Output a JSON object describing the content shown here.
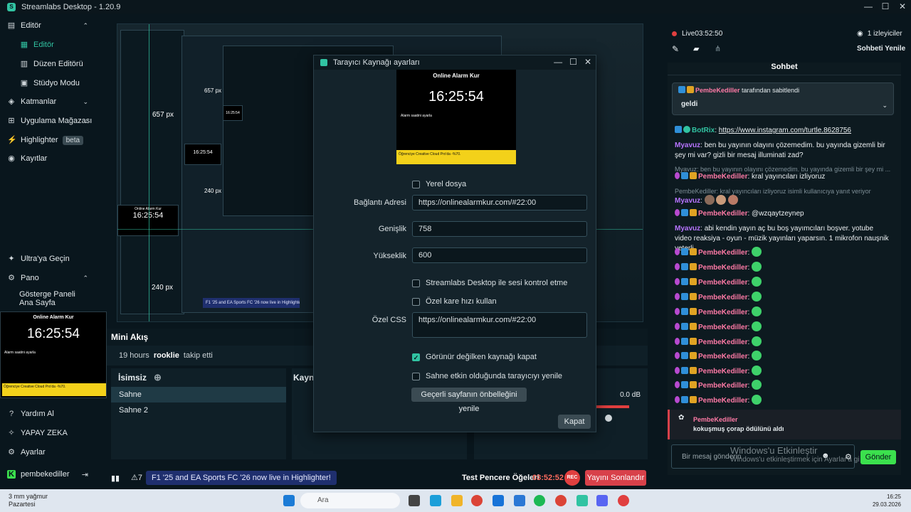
{
  "window": {
    "title": "Streamlabs Desktop - 1.20.9",
    "minimize": "—",
    "maximize": "☐",
    "close": "✕"
  },
  "sidebar": {
    "items": [
      {
        "label": "Editör",
        "icon": "layout-icon",
        "glyph": "▤",
        "chev": "⌃"
      },
      {
        "label": "Editör",
        "icon": "editor-icon",
        "glyph": "▦"
      },
      {
        "label": "Düzen Editörü",
        "icon": "layout-editor-icon",
        "glyph": "▥"
      },
      {
        "label": "Stüdyo Modu",
        "icon": "studio-mode-icon",
        "glyph": "▣"
      },
      {
        "label": "Katmanlar",
        "icon": "layers-icon",
        "glyph": "◈",
        "chev": "⌄"
      },
      {
        "label": "Uygulama Mağazası",
        "icon": "store-icon",
        "glyph": "⊞",
        "chev": "⌄"
      },
      {
        "label": "Highlighter",
        "icon": "highlighter-icon",
        "glyph": "⚡",
        "badge": "beta"
      },
      {
        "label": "Kayıtlar",
        "icon": "recordings-icon",
        "glyph": "◉"
      },
      {
        "label": "Ultra'ya Geçin",
        "icon": "ultra-icon",
        "glyph": "✦"
      },
      {
        "label": "Pano",
        "icon": "dashboard-icon",
        "glyph": "⚙",
        "chev": "⌃"
      },
      {
        "label": "Gösterge Paneli Ana Sayfa",
        "icon": "",
        "glyph": ""
      },
      {
        "label": "Yardım Al",
        "icon": "help-icon",
        "glyph": "?"
      },
      {
        "label": "YAPAY ZEKA",
        "icon": "ai-icon",
        "glyph": "✧"
      },
      {
        "label": "Ayarlar",
        "icon": "settings-icon",
        "glyph": "⚙"
      },
      {
        "label": "pembekediller",
        "icon": "kick-icon",
        "glyph": "K",
        "logout": "⇥"
      }
    ]
  },
  "clock": {
    "title": "Online Alarm Kur",
    "time": "16:25:54",
    "alarm_label": "Alarm saatini ayarla",
    "ad_text": "Öğrenciye Creative Cloud Pro'da -%70."
  },
  "preview_labels": {
    "px1": "657 px",
    "px2": "240 px",
    "px3": "240 px",
    "px4": "657 px"
  },
  "mini_stream": {
    "title": "Mini Akış",
    "time": "19 hours",
    "user": "rooklie",
    "action": "takip etti"
  },
  "scenes": {
    "title": "İsimsiz",
    "items": [
      "Sahne",
      "Sahne 2"
    ]
  },
  "sources": {
    "title": "Kayna"
  },
  "mixer": {
    "value": "0.0 dB"
  },
  "statusbar": {
    "news": "F1 '25 and EA Sports FC '26 now live in Highlighter!",
    "test_elements": "Test Pencere Öğeleri",
    "timer": "03:52:52",
    "rec": "REC",
    "end_stream": "Yayını Sonlandır",
    "notif_count": "7"
  },
  "dialog": {
    "title": "Tarayıcı Kaynağı ayarları",
    "local_file": "Yerel dosya",
    "url_label": "Bağlantı Adresi",
    "url_value": "https://onlinealarmkur.com/#22:00",
    "width_label": "Genişlik",
    "width_value": "758",
    "height_label": "Yükseklik",
    "height_value": "600",
    "audio_ctrl": "Streamlabs Desktop ile sesi kontrol etme",
    "custom_fps": "Özel kare hızı kullan",
    "css_label": "Özel CSS",
    "css_value": "https://onlinealarmkur.com/#22:00",
    "shutdown": "Görünür değilken kaynağı kapat",
    "refresh": "Sahne etkin olduğunda tarayıcıyı yenile",
    "refresh_btn": "Geçerli sayfanın önbelleğini yenile",
    "close_btn": "Kapat"
  },
  "chat_top": {
    "live": "Live",
    "time": "03:52:50",
    "viewers": "1 izleyiciler",
    "refresh": "Sohbeti Yenile"
  },
  "chat": {
    "title": "Sohbet",
    "pinned_by": "PembeKediller",
    "pinned_suffix": "tarafından sabitlendi",
    "pinned_text": "geldi",
    "messages": [
      {
        "user": "BotRix",
        "text": "https://www.instagram.com/turtle.8628756"
      },
      {
        "user": "Myavuz",
        "text": "ben bu yayının olayını çözemedim. bu yayında gizemli bir şey mi var? gizli bir mesaj illuminati zad?"
      },
      {
        "reply": "Myavuz: ben bu yayının olayını çözemedim. bu yayında gizemli bir şey mi ..."
      },
      {
        "user": "PembeKediller",
        "text": "kral yayıncıları izliyoruz"
      },
      {
        "reply": "PembeKediller: kral yayıncıları izliyoruz isimli kullanıcıya yanıt veriyor"
      },
      {
        "user": "Myavuz",
        "text": ""
      },
      {
        "user": "PembeKediller",
        "text": "@wzqaytzeynep"
      },
      {
        "user": "Myavuz",
        "text": "abi kendin yayın aç bu boş yayımcıları boşver. yotube video reaksiya - oyun - müzik yayınları yaparsın. 1 mikrofon nauşnik yeterli"
      }
    ],
    "emote_user": "PembeKediller",
    "reward_user": "PembeKediller",
    "reward_text": "kokuşmuş çorap ödülünü aldı",
    "input_placeholder": "Bir mesaj gönderin",
    "send": "Gönder"
  },
  "watermark": {
    "title": "Windows'u Etkinleştir",
    "subtitle": "Windows'u etkinleştirmek için Ayarlar'a gi"
  },
  "taskbar": {
    "weather_temp": "3 mm yağmur",
    "weather_day": "Pazartesi",
    "search": "Ara",
    "time": "16:25",
    "date": "29.03.2026"
  },
  "colors": {
    "accent": "#31c3a2",
    "live_red": "#e03f3f",
    "send_green": "#3be04d",
    "pink_user": "#ff7aa6",
    "purple_user": "#b774ff"
  }
}
